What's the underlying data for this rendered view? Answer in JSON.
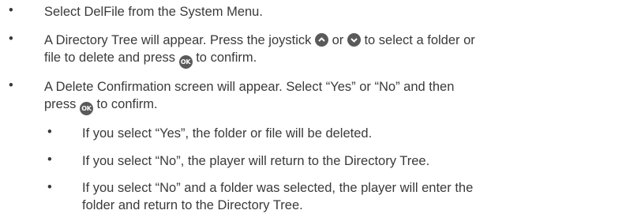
{
  "bullet_char": "•",
  "steps": [
    {
      "text": "Select DelFile from the System Menu."
    },
    {
      "part1": "A Directory Tree will appear. Press the joystick",
      "part2": "or",
      "part3": "to select a folder or",
      "part4": "file to delete and press",
      "part5": "to confirm."
    },
    {
      "part1": "A Delete Confirmation screen will appear. Select “Yes” or “No” and then",
      "part2": "press",
      "part3": "to confirm."
    }
  ],
  "sub_steps": [
    {
      "text": "If you select “Yes”, the folder or file will be deleted."
    },
    {
      "text": "If you select “No”, the player will return to the Directory Tree."
    },
    {
      "line1": "If you select “No” and a folder was selected, the player will enter the",
      "line2": "folder and return to the Directory Tree."
    }
  ],
  "icons": {
    "up": "joystick-up-icon",
    "down": "joystick-down-icon",
    "ok": "ok-button-icon",
    "ok_label": "OK"
  },
  "colors": {
    "text": "#3a3a3a",
    "icon_fill": "#5a5a5a"
  }
}
